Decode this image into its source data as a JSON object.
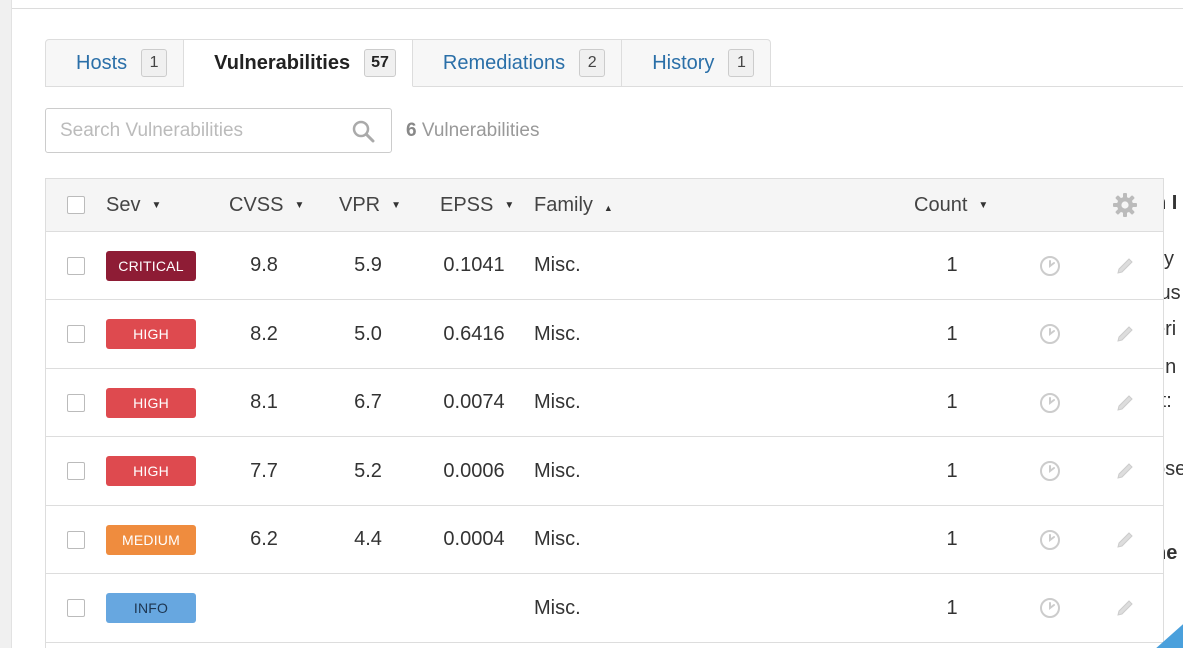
{
  "tabs": [
    {
      "label": "Hosts",
      "count": "1",
      "active": false
    },
    {
      "label": "Vulnerabilities",
      "count": "57",
      "active": true
    },
    {
      "label": "Remediations",
      "count": "2",
      "active": false
    },
    {
      "label": "History",
      "count": "1",
      "active": false
    }
  ],
  "search": {
    "placeholder": "Search Vulnerabilities",
    "value": ""
  },
  "summary": {
    "count": "6",
    "label": " Vulnerabilities"
  },
  "table": {
    "columns": {
      "sev": "Sev",
      "cvss": "CVSS",
      "vpr": "VPR",
      "epss": "EPSS",
      "family": "Family",
      "count": "Count"
    },
    "sort_glyphs": {
      "desc": "▼",
      "asc": "▲"
    },
    "rows": [
      {
        "severity": "CRITICAL",
        "cvss": "9.8",
        "vpr": "5.9",
        "epss": "0.1041",
        "family": "Misc.",
        "count": "1"
      },
      {
        "severity": "HIGH",
        "cvss": "8.2",
        "vpr": "5.0",
        "epss": "0.6416",
        "family": "Misc.",
        "count": "1"
      },
      {
        "severity": "HIGH",
        "cvss": "8.1",
        "vpr": "6.7",
        "epss": "0.0074",
        "family": "Misc.",
        "count": "1"
      },
      {
        "severity": "HIGH",
        "cvss": "7.7",
        "vpr": "5.2",
        "epss": "0.0006",
        "family": "Misc.",
        "count": "1"
      },
      {
        "severity": "MEDIUM",
        "cvss": "6.2",
        "vpr": "4.4",
        "epss": "0.0004",
        "family": "Misc.",
        "count": "1"
      },
      {
        "severity": "INFO",
        "cvss": "",
        "vpr": "",
        "epss": "",
        "family": "Misc.",
        "count": "1"
      }
    ]
  },
  "severity_colors": {
    "CRITICAL": "#8e1c35",
    "HIGH": "#de4a4f",
    "MEDIUM": "#ef8c3e",
    "INFO": "#67a7e0"
  },
  "right_panel": {
    "fragments": [
      {
        "text": "n I",
        "bold": true
      },
      {
        "text": "cy",
        "bold": false
      },
      {
        "text": "tus",
        "bold": false
      },
      {
        "text": "eri",
        "bold": false
      },
      {
        "text": "nn",
        "bold": false
      },
      {
        "text": "rt:",
        "bold": false
      },
      {
        "text": ":",
        "bold": false
      },
      {
        "text": "ose",
        "bold": false
      },
      {
        "text": "ne",
        "bold": true
      }
    ]
  },
  "icons": {
    "search": "magnifier-icon",
    "settings": "gear-icon",
    "row_clock": "clock-icon",
    "row_edit": "pencil-icon"
  }
}
